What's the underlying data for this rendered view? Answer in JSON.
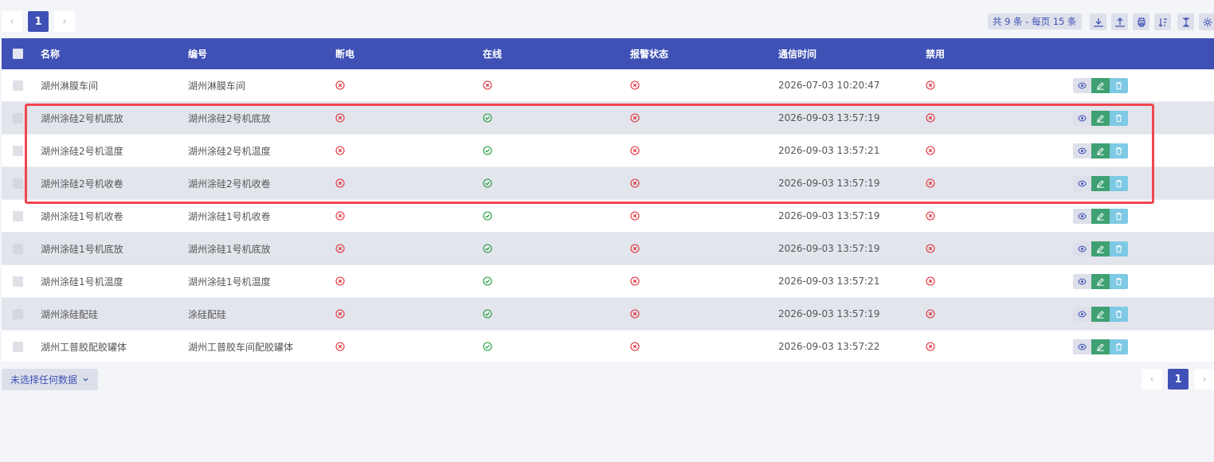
{
  "pagination_top": {
    "prev": "‹",
    "page": "1",
    "next": "›"
  },
  "summary": "共 9 条 - 每页 15 条",
  "toolbar": [
    {
      "name": "download-icon"
    },
    {
      "name": "upload-icon"
    },
    {
      "name": "print-icon"
    },
    {
      "name": "sort-icon"
    },
    {
      "name": "column-width-icon"
    },
    {
      "name": "settings-icon"
    }
  ],
  "table": {
    "columns": [
      "名称",
      "编号",
      "断电",
      "在线",
      "报警状态",
      "通信时间",
      "禁用"
    ],
    "rows": [
      {
        "name": "湖州淋膜车间",
        "code": "湖州淋膜车间",
        "power_off": "no",
        "online": "no",
        "alarm": "no",
        "time": "2026-07-03 10:20:47",
        "disabled": "no"
      },
      {
        "name": "湖州涂硅2号机底放",
        "code": "湖州涂硅2号机底放",
        "power_off": "no",
        "online": "yes",
        "alarm": "no",
        "time": "2026-09-03 13:57:19",
        "disabled": "no"
      },
      {
        "name": "湖州涂硅2号机温度",
        "code": "湖州涂硅2号机温度",
        "power_off": "no",
        "online": "yes",
        "alarm": "no",
        "time": "2026-09-03 13:57:21",
        "disabled": "no"
      },
      {
        "name": "湖州涂硅2号机收卷",
        "code": "湖州涂硅2号机收卷",
        "power_off": "no",
        "online": "yes",
        "alarm": "no",
        "time": "2026-09-03 13:57:19",
        "disabled": "no"
      },
      {
        "name": "湖州涂硅1号机收卷",
        "code": "湖州涂硅1号机收卷",
        "power_off": "no",
        "online": "yes",
        "alarm": "no",
        "time": "2026-09-03 13:57:19",
        "disabled": "no"
      },
      {
        "name": "湖州涂硅1号机底放",
        "code": "湖州涂硅1号机底放",
        "power_off": "no",
        "online": "yes",
        "alarm": "no",
        "time": "2026-09-03 13:57:19",
        "disabled": "no"
      },
      {
        "name": "湖州涂硅1号机温度",
        "code": "湖州涂硅1号机温度",
        "power_off": "no",
        "online": "yes",
        "alarm": "no",
        "time": "2026-09-03 13:57:21",
        "disabled": "no"
      },
      {
        "name": "湖州涂硅配硅",
        "code": "涂硅配硅",
        "power_off": "no",
        "online": "yes",
        "alarm": "no",
        "time": "2026-09-03 13:57:19",
        "disabled": "no"
      },
      {
        "name": "湖州工普胶配胶罐体",
        "code": "湖州工普胶车间配胶罐体",
        "power_off": "no",
        "online": "yes",
        "alarm": "no",
        "time": "2026-09-03 13:57:22",
        "disabled": "no"
      }
    ]
  },
  "footer": {
    "selection_label": "未选择任何数据"
  },
  "pagination_bottom": {
    "prev": "‹",
    "page": "1",
    "next": "›"
  },
  "colors": {
    "accent": "#3f51b5",
    "status_yes": "#1e9c3c",
    "status_no": "#e0303a",
    "highlight": "#f0464f"
  }
}
